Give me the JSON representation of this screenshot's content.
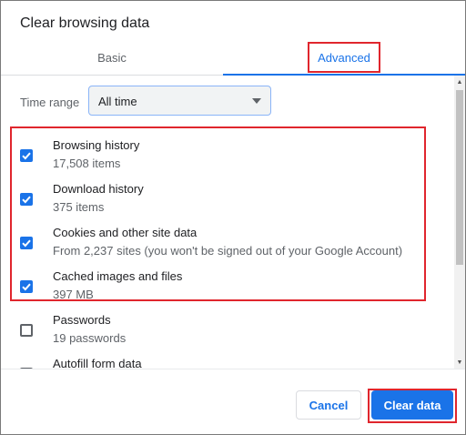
{
  "dialog": {
    "title": "Clear browsing data"
  },
  "tabs": [
    {
      "label": "Basic",
      "active": false
    },
    {
      "label": "Advanced",
      "active": true
    }
  ],
  "time_range": {
    "label": "Time range",
    "value": "All time"
  },
  "items": [
    {
      "label": "Browsing history",
      "sub": "17,508 items",
      "checked": true
    },
    {
      "label": "Download history",
      "sub": "375 items",
      "checked": true
    },
    {
      "label": "Cookies and other site data",
      "sub": "From 2,237 sites (you won't be signed out of your Google Account)",
      "checked": true
    },
    {
      "label": "Cached images and files",
      "sub": "397 MB",
      "checked": true
    },
    {
      "label": "Passwords",
      "sub": "19 passwords",
      "checked": false
    },
    {
      "label": "Autofill form data",
      "sub": "",
      "checked": false
    }
  ],
  "buttons": {
    "cancel": "Cancel",
    "clear": "Clear data"
  },
  "colors": {
    "accent": "#1a73e8",
    "highlight": "#e0262d"
  }
}
